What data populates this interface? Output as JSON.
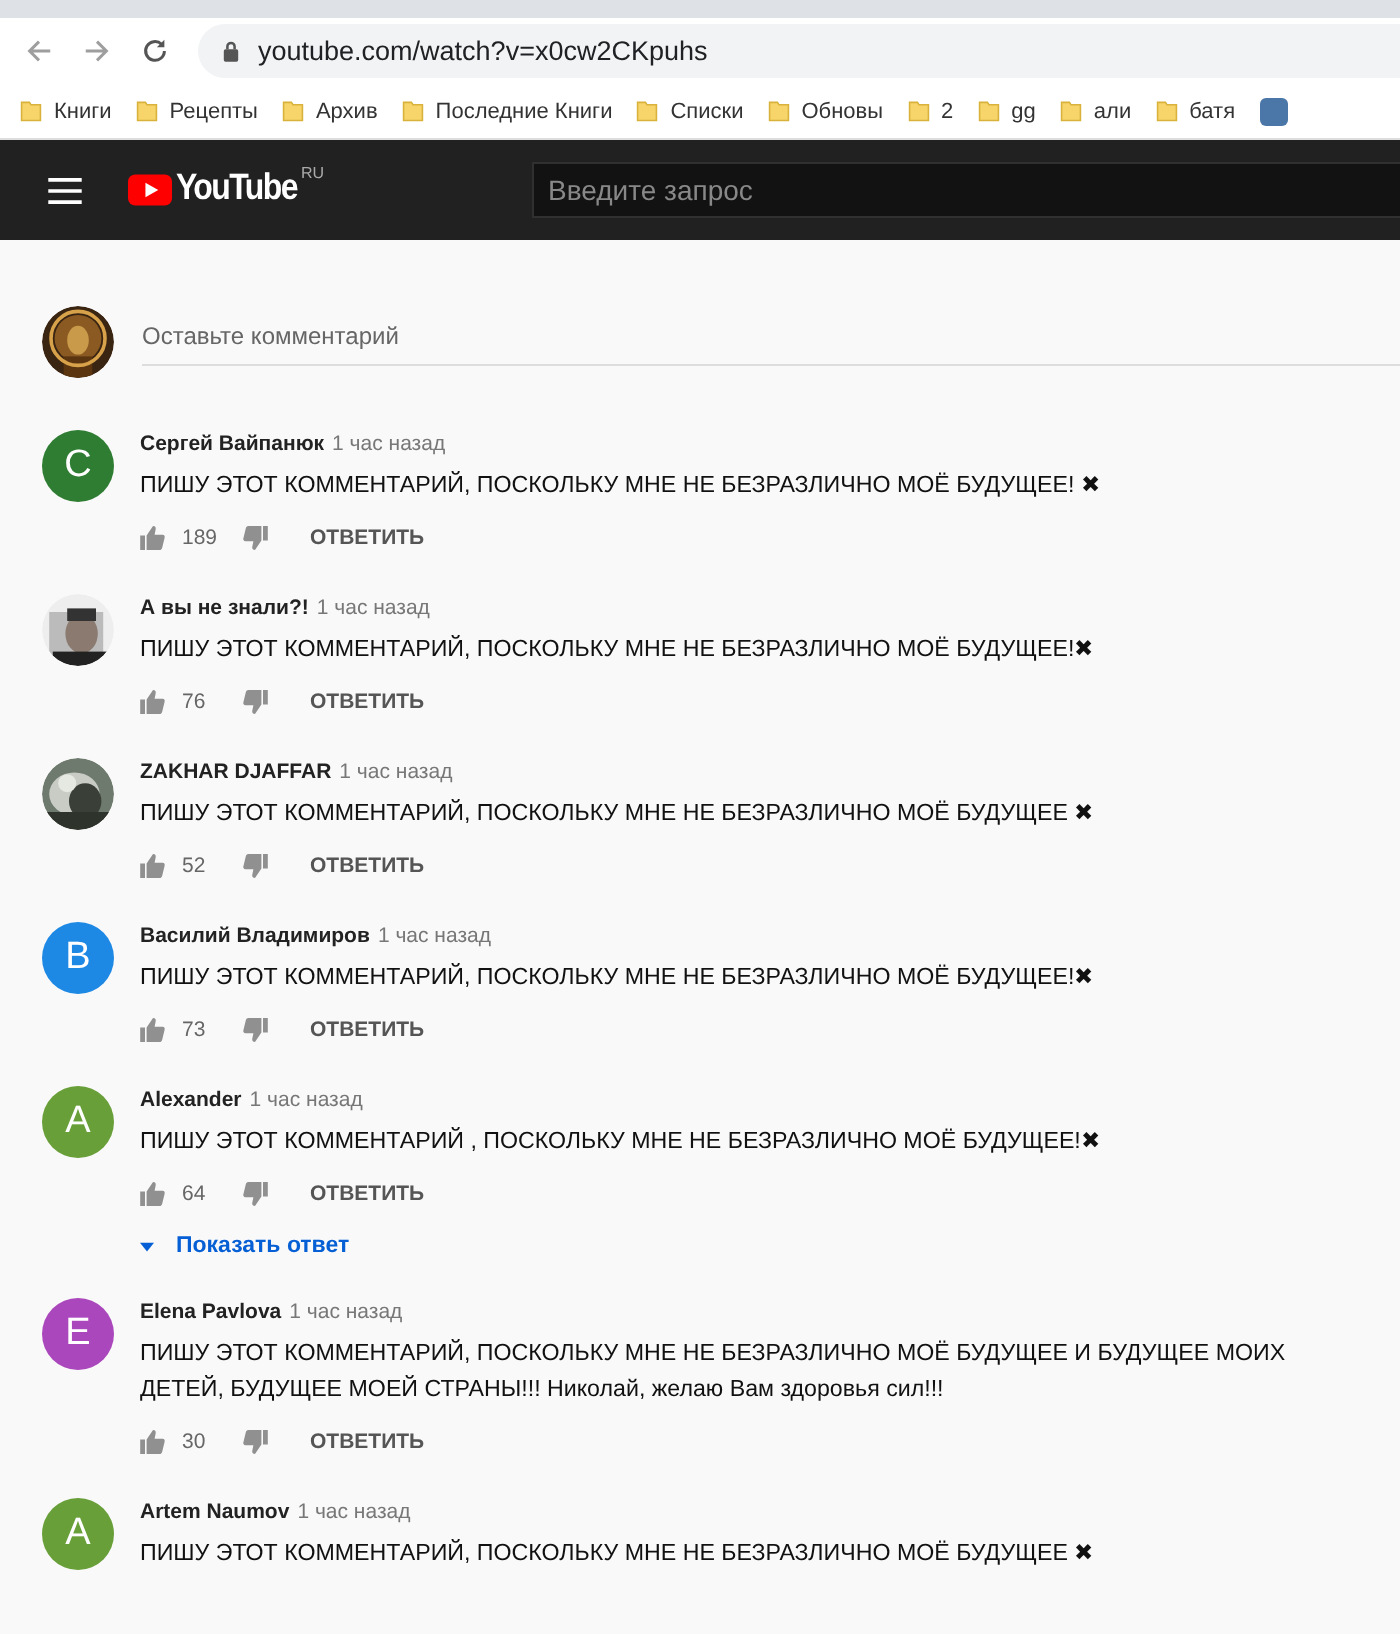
{
  "browser": {
    "url": "youtube.com/watch?v=x0cw2CKpuhs",
    "bookmarks": [
      {
        "label": "Книги"
      },
      {
        "label": "Рецепты"
      },
      {
        "label": "Архив"
      },
      {
        "label": "Последние Книги"
      },
      {
        "label": "Списки"
      },
      {
        "label": "Обновы"
      },
      {
        "label": "2"
      },
      {
        "label": "gg"
      },
      {
        "label": "али"
      },
      {
        "label": "батя"
      }
    ]
  },
  "header": {
    "logo": "YouTube",
    "region": "RU",
    "search": {
      "placeholder": "Введите запрос"
    }
  },
  "comment_box": {
    "placeholder": "Оставьте комментарий"
  },
  "comments": [
    {
      "author": "Сергей Вайпанюк",
      "time": "1 час назад",
      "avatar": {
        "kind": "letter",
        "letter": "С",
        "color": "#2e7d32"
      },
      "text": "ПИШУ ЭТОТ КОММЕНТАРИЙ, ПОСКОЛЬКУ МНЕ НЕ БЕЗРАЗЛИЧНО МОЁ БУДУЩЕЕ! ✖",
      "likes": "189",
      "reply": "ОТВЕТИТЬ"
    },
    {
      "author": "А вы не знали?!",
      "time": "1 час назад",
      "text": "ПИШУ ЭТОТ КОММЕНТАРИЙ, ПОСКОЛЬКУ МНЕ НЕ БЕЗРАЗЛИЧНО МОЁ БУДУЩЕЕ!✖",
      "likes": "76",
      "reply": "ОТВЕТИТЬ"
    },
    {
      "author": "ZAKHAR DJAFFAR",
      "time": "1 час назад",
      "text": "ПИШУ ЭТОТ КОММЕНТАРИЙ, ПОСКОЛЬКУ МНЕ НЕ БЕЗРАЗЛИЧНО МОЁ БУДУЩЕЕ ✖",
      "likes": "52",
      "reply": "ОТВЕТИТЬ"
    },
    {
      "author": "Василий Владимиров",
      "time": "1 час назад",
      "avatar": {
        "kind": "letter",
        "letter": "В",
        "color": "#1e88e5"
      },
      "text": "ПИШУ ЭТОТ КОММЕНТАРИЙ, ПОСКОЛЬКУ МНЕ НЕ БЕЗРАЗЛИЧНО МОЁ БУДУЩЕЕ!✖",
      "likes": "73",
      "reply": "ОТВЕТИТЬ"
    },
    {
      "author": "Alexander",
      "time": "1 час назад",
      "avatar": {
        "kind": "letter",
        "letter": "A",
        "color": "#689f38"
      },
      "text": "ПИШУ ЭТОТ КОММЕНТАРИЙ , ПОСКОЛЬКУ МНЕ НЕ БЕЗРАЗЛИЧНО МОЁ БУДУЩЕЕ!✖",
      "likes": "64",
      "reply": "ОТВЕТИТЬ",
      "show_replies": "Показать ответ"
    },
    {
      "author": "Elena Pavlova",
      "time": "1 час назад",
      "avatar": {
        "kind": "letter",
        "letter": "E",
        "color": "#ab47bc"
      },
      "text": "ПИШУ ЭТОТ КОММЕНТАРИЙ, ПОСКОЛЬКУ МНЕ НЕ БЕЗРАЗЛИЧНО МОЁ БУДУЩЕЕ И БУДУЩЕЕ МОИХ ДЕТЕЙ, БУДУЩЕЕ МОЕЙ СТРАНЫ!!! Николай, желаю Вам здоровья сил!!!",
      "likes": "30",
      "reply": "ОТВЕТИТЬ"
    },
    {
      "author": "Artem Naumov",
      "time": "1 час назад",
      "avatar": {
        "kind": "letter",
        "letter": "A",
        "color": "#689f38"
      },
      "text": "ПИШУ ЭТОТ КОММЕНТАРИЙ, ПОСКОЛЬКУ МНЕ НЕ БЕЗРАЗЛИЧНО МОЁ БУДУЩЕЕ ✖"
    }
  ]
}
